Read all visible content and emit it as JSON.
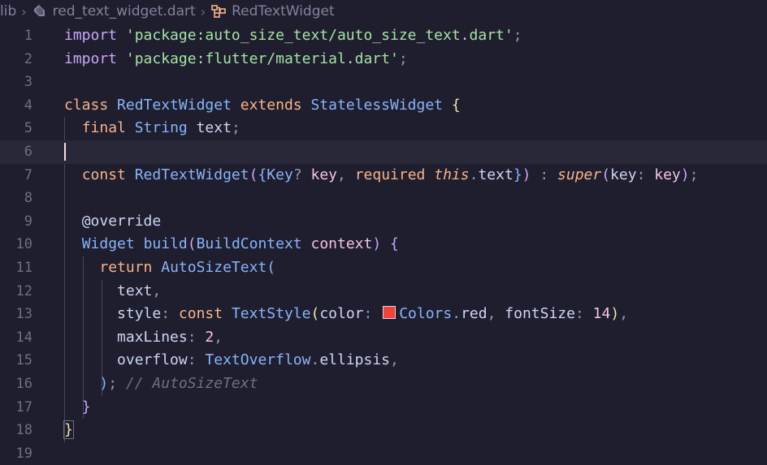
{
  "breadcrumb": {
    "root": "lib",
    "file": "red_text_widget.dart",
    "symbol": "RedTextWidget",
    "dart_icon": "dart-file-icon",
    "symbol_icon": "class-symbol-icon"
  },
  "line_numbers": [
    "1",
    "2",
    "3",
    "4",
    "5",
    "6",
    "7",
    "8",
    "9",
    "10",
    "11",
    "12",
    "13",
    "14",
    "15",
    "16",
    "17",
    "18",
    "19"
  ],
  "code": {
    "l1": {
      "kw": "import",
      "sp": " ",
      "str": "'package:auto_size_text/auto_size_text.dart'",
      "semi": ";"
    },
    "l2": {
      "kw": "import",
      "sp": " ",
      "str": "'package:flutter/material.dart'",
      "semi": ";"
    },
    "l4": {
      "kw_class": "class",
      "name": "RedTextWidget",
      "kw_extends": "extends",
      "base": "StatelessWidget",
      "brace": "{"
    },
    "l5": {
      "kw": "final",
      "type": "String",
      "ident": "text",
      "semi": ";"
    },
    "l7": {
      "kw": "const",
      "name": "RedTextWidget",
      "paren": "(",
      "brace_open": "{",
      "type": "Key",
      "q": "?",
      "param": "key",
      "comma": ",",
      "required": "required",
      "this": "this",
      "dot": ".",
      "field": "text",
      "brace_close": "}",
      "paren_close": ")",
      "colon": " : ",
      "super": "super",
      "paren2": "(",
      "named": "key",
      "colon2": ":",
      "arg": "key",
      "paren2_close": ")",
      "semi": ";"
    },
    "l9": {
      "annotation": "@override"
    },
    "l10": {
      "type": "Widget",
      "fn": "build",
      "paren": "(",
      "ptype": "BuildContext",
      "param": "context",
      "paren_close": ")",
      "brace": "{"
    },
    "l11": {
      "kw": "return",
      "fn": "AutoSizeText",
      "paren": "("
    },
    "l12": {
      "ident": "text",
      "comma": ","
    },
    "l13": {
      "key": "style",
      "colon": ":",
      "kw": "const",
      "fn": "TextStyle",
      "paren": "(",
      "arg1": "color",
      "colon1": ":",
      "colors": "Colors",
      "dot": ".",
      "red": "red",
      "comma": ",",
      "arg2": "fontSize",
      "colon2": ":",
      "num": "14",
      "paren_close": ")",
      "comma2": ",",
      "swatch_color": "#f44336"
    },
    "l14": {
      "key": "maxLines",
      "colon": ":",
      "num": "2",
      "comma": ","
    },
    "l15": {
      "key": "overflow",
      "colon": ":",
      "type": "TextOverflow",
      "dot": ".",
      "member": "ellipsis",
      "comma": ","
    },
    "l16": {
      "paren": ")",
      "semi": ";",
      "comment": "// AutoSizeText"
    },
    "l17": {
      "brace": "}"
    },
    "l18": {
      "brace": "}"
    }
  },
  "colors": {
    "background": "#1e1e2e",
    "keyword": "#cba6f7",
    "string": "#a6e3a1",
    "type": "#89b4fa",
    "comment": "#6c7086",
    "swatch": "#f44336"
  }
}
